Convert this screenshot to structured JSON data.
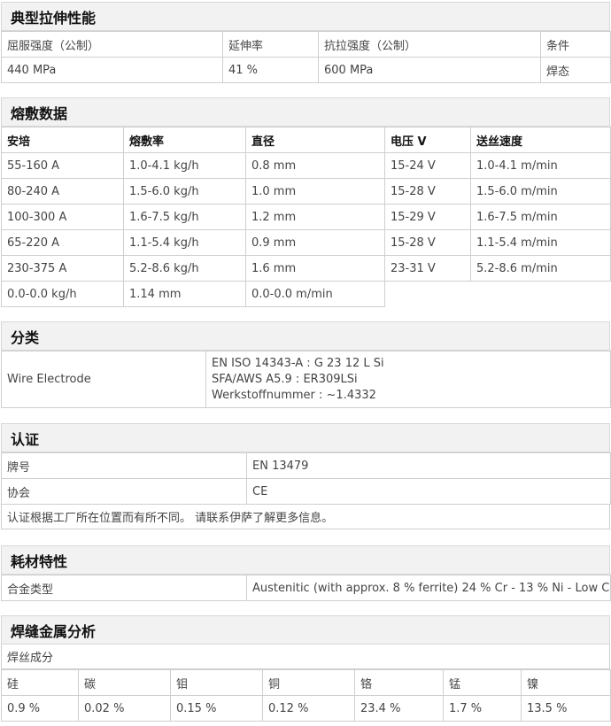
{
  "tensile": {
    "title": "典型拉伸性能",
    "headers": [
      "屈服强度（公制）",
      "延伸率",
      "抗拉强度（公制）",
      "条件"
    ],
    "values": [
      "440 MPa",
      "41 %",
      "600 MPa",
      "焊态"
    ]
  },
  "deposition": {
    "title": "熔敷数据",
    "headers": [
      "安培",
      "熔敷率",
      "直径",
      "电压 V",
      "送丝速度"
    ],
    "rows": [
      [
        "55-160 A",
        "1.0-4.1 kg/h",
        "0.8 mm",
        "15-24 V",
        "1.0-4.1 m/min"
      ],
      [
        "80-240 A",
        "1.5-6.0 kg/h",
        "1.0 mm",
        "15-28 V",
        "1.5-6.0 m/min"
      ],
      [
        "100-300 A",
        "1.6-7.5 kg/h",
        "1.2 mm",
        "15-29 V",
        "1.6-7.5 m/min"
      ],
      [
        "65-220 A",
        "1.1-5.4 kg/h",
        "0.9 mm",
        "15-28 V",
        "1.1-5.4 m/min"
      ],
      [
        "230-375 A",
        "5.2-8.6 kg/h",
        "1.6 mm",
        "23-31 V",
        "5.2-8.6 m/min"
      ]
    ],
    "extra_row": [
      "0.0-0.0 kg/h",
      "1.14 mm",
      "0.0-0.0 m/min"
    ]
  },
  "classification": {
    "title": "分类",
    "label": "Wire Electrode",
    "lines": [
      "EN ISO 14343-A : G 23 12 L Si",
      "SFA/AWS A5.9 : ER309LSi",
      "Werkstoffnummer : ~1.4332"
    ]
  },
  "certification": {
    "title": "认证",
    "rows": [
      [
        "牌号",
        "EN 13479"
      ],
      [
        "协会",
        "CE"
      ]
    ],
    "note": "认证根据工厂所在位置而有所不同。 请联系伊萨了解更多信息。"
  },
  "consumable": {
    "title": "耗材特性",
    "label": "合金类型",
    "value": "Austenitic (with approx. 8 % ferrite) 24 % Cr - 13 % Ni - Low C"
  },
  "weld_metal": {
    "title": "焊缝金属分析",
    "sub": "焊丝成分",
    "headers": [
      "硅",
      "碳",
      "钼",
      "铜",
      "铬",
      "锰",
      "镍"
    ],
    "values": [
      "0.9 %",
      "0.02 %",
      "0.15 %",
      "0.12 %",
      "23.4 %",
      "1.7 %",
      "13.5 %"
    ]
  }
}
